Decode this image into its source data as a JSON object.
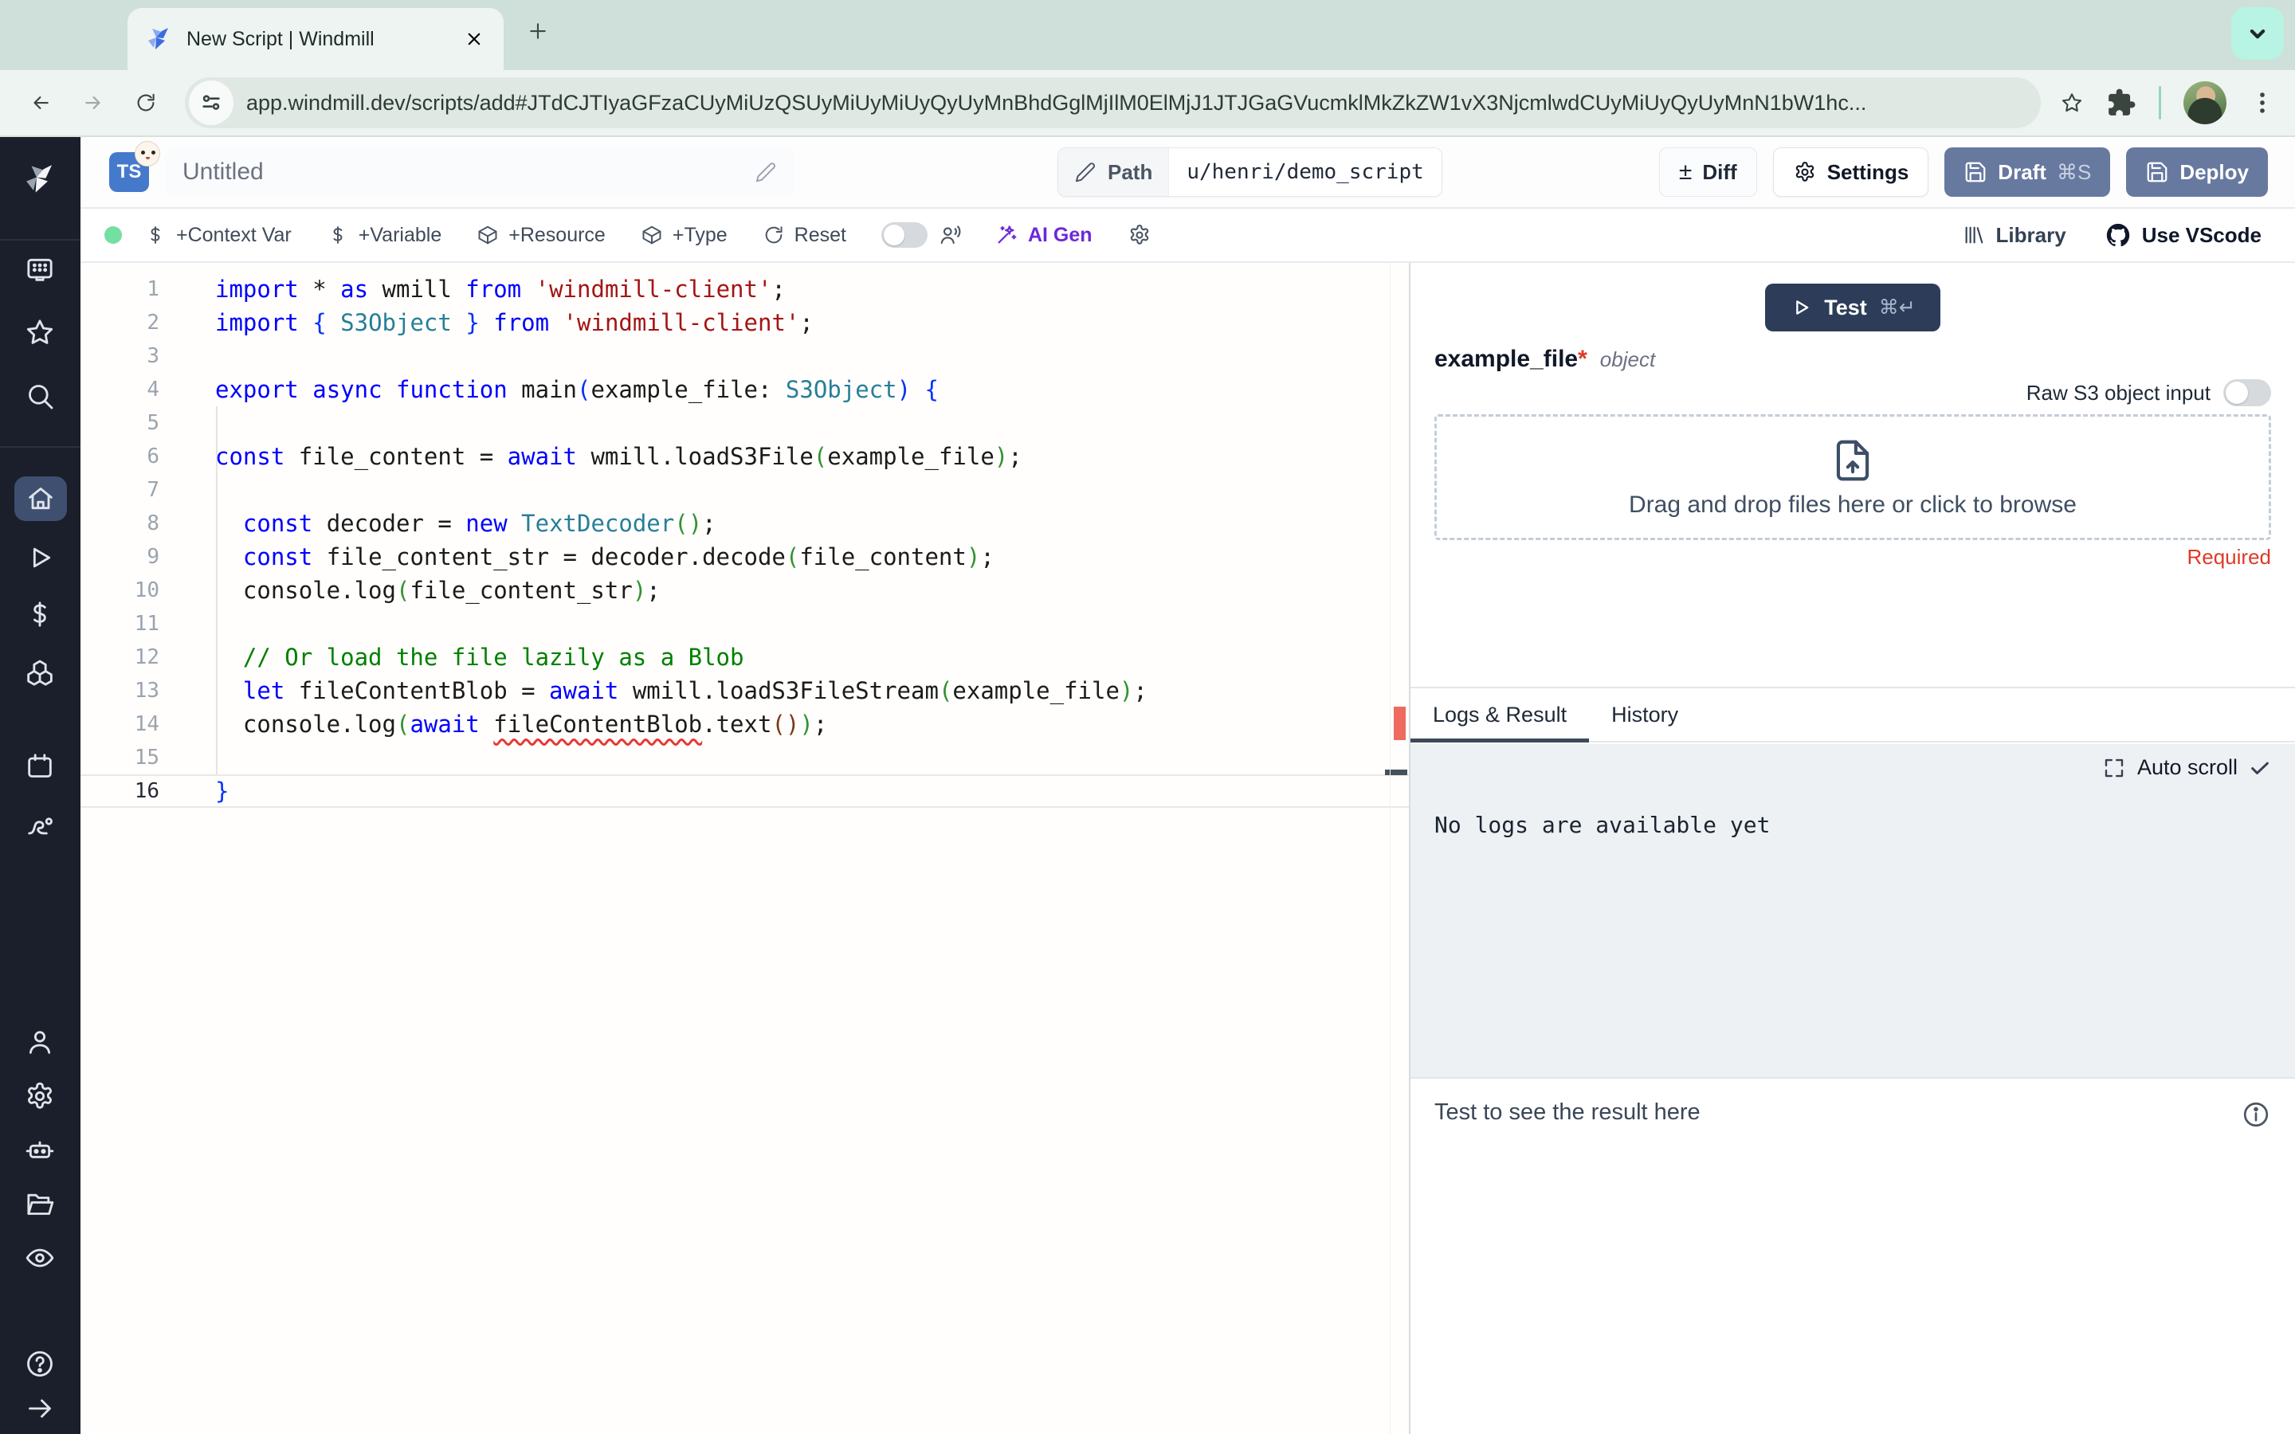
{
  "colors": {
    "accent-blue-button": "#67799f",
    "test-button": "#2d3c59",
    "required-red": "#dd3a27",
    "ai-gen-purple": "#6d28d9",
    "sidebar-active": "#3f4f70",
    "status-green": "#74dfa2",
    "tab-underline": "#3d4859"
  },
  "browser": {
    "tab_title": "New Script | Windmill",
    "url": "app.windmill.dev/scripts/add#JTdCJTIyaGFzaCUyMiUzQSUyMiUyMiUyQyUyMnBhdGglMjIlM0ElMjJ1JTJGaGVucmklMkZkZW1vX3NjcmlwdCUyMiUyQyUyMnN1bW1hc..."
  },
  "sidebar": {
    "items": [
      {
        "icon": "windmill-logo-icon",
        "key": "logo"
      },
      {
        "icon": "workspace-icon",
        "key": "workspace"
      },
      {
        "icon": "star-icon",
        "key": "favorites"
      },
      {
        "icon": "search-icon",
        "key": "search"
      },
      {
        "icon": "home-icon",
        "key": "home",
        "active": true
      },
      {
        "icon": "play-icon",
        "key": "runs"
      },
      {
        "icon": "dollar-icon",
        "key": "variables"
      },
      {
        "icon": "cubes-icon",
        "key": "resources"
      },
      {
        "icon": "calendar-icon",
        "key": "schedules"
      },
      {
        "icon": "route-icon",
        "key": "flows"
      },
      {
        "icon": "user-icon",
        "key": "account"
      },
      {
        "icon": "gear-icon",
        "key": "settings"
      },
      {
        "icon": "robot-icon",
        "key": "workers"
      },
      {
        "icon": "folder-icon",
        "key": "folders"
      },
      {
        "icon": "eye-icon",
        "key": "audit-logs"
      },
      {
        "icon": "help-icon",
        "key": "help"
      },
      {
        "icon": "arrow-right-icon",
        "key": "expand"
      }
    ]
  },
  "header": {
    "language_badge": "TS",
    "script_title": "Untitled",
    "path_label": "Path",
    "path_value": "u/henri/demo_script",
    "diff_label": "Diff",
    "diff_glyph": "±",
    "settings_label": "Settings",
    "draft_label": "Draft",
    "draft_shortcut": "⌘S",
    "deploy_label": "Deploy"
  },
  "action_bar": {
    "items": [
      {
        "icon": "dollar-icon",
        "label": "+Context Var"
      },
      {
        "icon": "dollar-icon",
        "label": "+Variable"
      },
      {
        "icon": "package-icon",
        "label": "+Resource"
      },
      {
        "icon": "package-icon",
        "label": "+Type"
      },
      {
        "icon": "reset-icon",
        "label": "Reset"
      }
    ],
    "ai_gen_label": "AI Gen",
    "library_label": "Library",
    "vscode_label": "Use VScode"
  },
  "editor": {
    "active_line": 16,
    "lines": [
      {
        "n": 1,
        "tokens": [
          [
            "kw",
            "import"
          ],
          [
            "d",
            " * "
          ],
          [
            "kw",
            "as"
          ],
          [
            "d",
            " wmill "
          ],
          [
            "kw",
            "from"
          ],
          [
            "d",
            " "
          ],
          [
            "str",
            "'windmill-client'"
          ],
          [
            "d",
            ";"
          ]
        ]
      },
      {
        "n": 2,
        "tokens": [
          [
            "kw",
            "import"
          ],
          [
            "d",
            " "
          ],
          [
            "b1",
            "{"
          ],
          [
            "d",
            " "
          ],
          [
            "ty",
            "S3Object"
          ],
          [
            "d",
            " "
          ],
          [
            "b1",
            "}"
          ],
          [
            "d",
            " "
          ],
          [
            "kw",
            "from"
          ],
          [
            "d",
            " "
          ],
          [
            "str",
            "'windmill-client'"
          ],
          [
            "d",
            ";"
          ]
        ]
      },
      {
        "n": 3,
        "tokens": []
      },
      {
        "n": 4,
        "tokens": [
          [
            "kw",
            "export"
          ],
          [
            "d",
            " "
          ],
          [
            "kw",
            "async"
          ],
          [
            "d",
            " "
          ],
          [
            "kw",
            "function"
          ],
          [
            "d",
            " main"
          ],
          [
            "b1",
            "("
          ],
          [
            "d",
            "example_file: "
          ],
          [
            "ty",
            "S3Object"
          ],
          [
            "b1",
            ")"
          ],
          [
            "d",
            " "
          ],
          [
            "b1",
            "{"
          ]
        ]
      },
      {
        "n": 5,
        "tokens": []
      },
      {
        "n": 6,
        "tokens": [
          [
            "kw",
            "const"
          ],
          [
            "d",
            " file_content = "
          ],
          [
            "kw",
            "await"
          ],
          [
            "d",
            " wmill.loadS3File"
          ],
          [
            "b2",
            "("
          ],
          [
            "d",
            "example_file"
          ],
          [
            "b2",
            ")"
          ],
          [
            "d",
            ";"
          ]
        ]
      },
      {
        "n": 7,
        "tokens": []
      },
      {
        "n": 8,
        "tokens": [
          [
            "d",
            "  "
          ],
          [
            "kw",
            "const"
          ],
          [
            "d",
            " decoder = "
          ],
          [
            "kw",
            "new"
          ],
          [
            "d",
            " "
          ],
          [
            "ty",
            "TextDecoder"
          ],
          [
            "b2",
            "("
          ],
          [
            "b2",
            ")"
          ],
          [
            "d",
            ";"
          ]
        ]
      },
      {
        "n": 9,
        "tokens": [
          [
            "d",
            "  "
          ],
          [
            "kw",
            "const"
          ],
          [
            "d",
            " file_content_str = decoder.decode"
          ],
          [
            "b2",
            "("
          ],
          [
            "d",
            "file_content"
          ],
          [
            "b2",
            ")"
          ],
          [
            "d",
            ";"
          ]
        ]
      },
      {
        "n": 10,
        "tokens": [
          [
            "d",
            "  console.log"
          ],
          [
            "b2",
            "("
          ],
          [
            "d",
            "file_content_str"
          ],
          [
            "b2",
            ")"
          ],
          [
            "d",
            ";"
          ]
        ]
      },
      {
        "n": 11,
        "tokens": []
      },
      {
        "n": 12,
        "tokens": [
          [
            "cm",
            "  // Or load the file lazily as a Blob"
          ]
        ]
      },
      {
        "n": 13,
        "tokens": [
          [
            "d",
            "  "
          ],
          [
            "kw",
            "let"
          ],
          [
            "d",
            " fileContentBlob = "
          ],
          [
            "kw",
            "await"
          ],
          [
            "d",
            " wmill.loadS3FileStream"
          ],
          [
            "b2",
            "("
          ],
          [
            "d",
            "example_file"
          ],
          [
            "b2",
            ")"
          ],
          [
            "d",
            ";"
          ]
        ]
      },
      {
        "n": 14,
        "tokens": [
          [
            "d",
            "  console.log"
          ],
          [
            "b2",
            "("
          ],
          [
            "kw",
            "await"
          ],
          [
            "d",
            " "
          ],
          [
            "sq",
            "fileContentBlob"
          ],
          [
            "d",
            ".text"
          ],
          [
            "b3",
            "("
          ],
          [
            "b3",
            ")"
          ],
          [
            "b2",
            ")"
          ],
          [
            "d",
            ";"
          ]
        ]
      },
      {
        "n": 15,
        "tokens": []
      },
      {
        "n": 16,
        "tokens": [
          [
            "b1",
            "}"
          ]
        ]
      }
    ]
  },
  "panel": {
    "test_label": "Test",
    "test_shortcut": "⌘↵",
    "arg_name": "example_file",
    "arg_required_mark": "*",
    "arg_type": "object",
    "raw_s3_label": "Raw S3 object input",
    "dropzone_label": "Drag and drop files here or click to browse",
    "required_label": "Required",
    "tabs": [
      {
        "label": "Logs & Result",
        "active": true
      },
      {
        "label": "History"
      }
    ],
    "auto_scroll_label": "Auto scroll",
    "logs_empty_text": "No logs are available yet",
    "result_placeholder": "Test to see the result here"
  }
}
